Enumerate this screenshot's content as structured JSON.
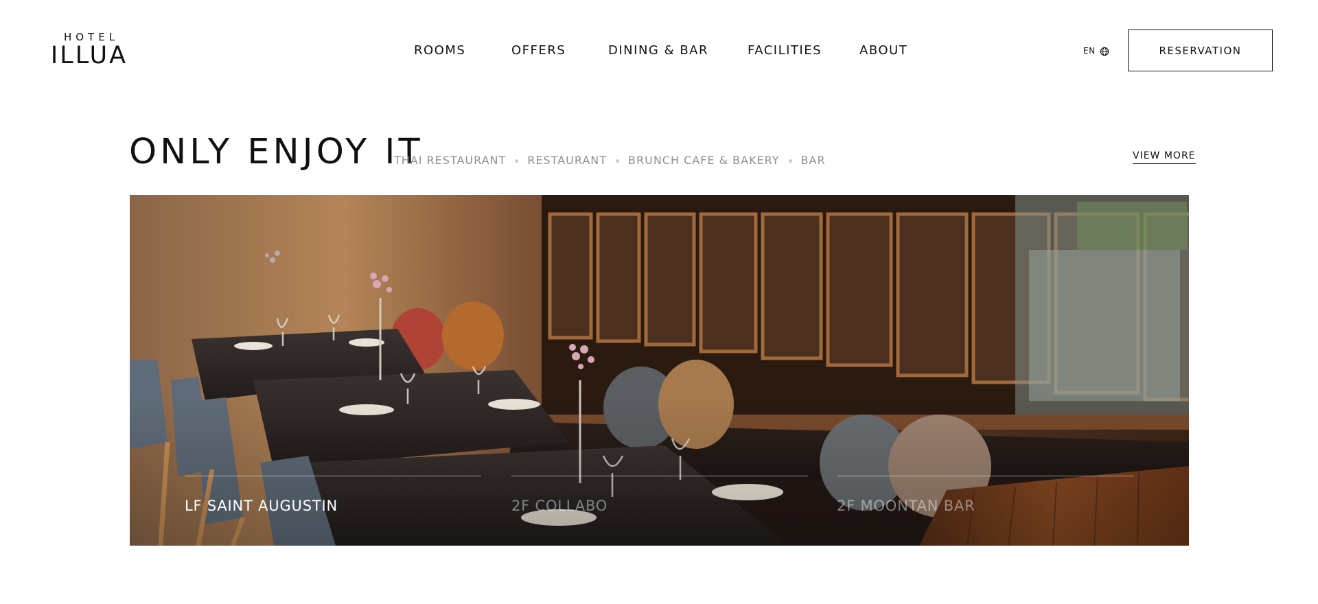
{
  "brand": {
    "logo_top": "HOTEL",
    "logo_main": "ILLUA"
  },
  "nav": {
    "items": [
      {
        "label": "ROOMS"
      },
      {
        "label": "OFFERS"
      },
      {
        "label": "DINING & BAR"
      },
      {
        "label": "FACILITIES"
      },
      {
        "label": "ABOUT"
      }
    ]
  },
  "language": {
    "label": "EN",
    "icon": "globe-icon"
  },
  "reservation": {
    "label": "RESERVATION"
  },
  "section": {
    "title": "ONLY ENJOY IT",
    "categories": [
      {
        "label": "THAI RESTAURANT"
      },
      {
        "label": "RESTAURANT"
      },
      {
        "label": "BRUNCH CAFE & BAKERY"
      },
      {
        "label": "BAR"
      }
    ],
    "view_more": "VIEW MORE"
  },
  "hero": {
    "venues": [
      {
        "label": "LF SAINT AUGUSTIN",
        "active": true
      },
      {
        "label": "2F COLLABO",
        "active": false
      },
      {
        "label": "2F MOONTAN BAR",
        "active": false
      }
    ]
  },
  "colors": {
    "text": "#111111",
    "muted": "#8f8f8f",
    "background": "#ffffff"
  }
}
